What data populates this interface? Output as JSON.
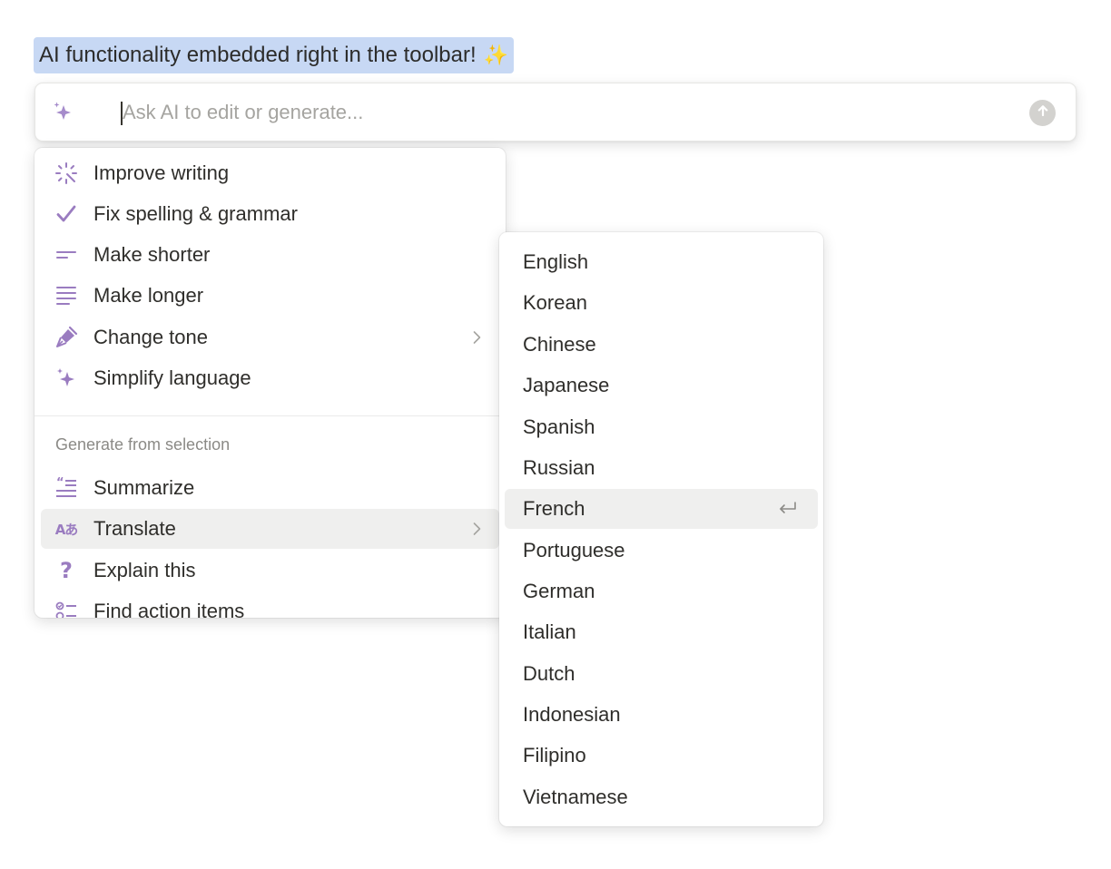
{
  "selection": {
    "text": "AI functionality embedded right in the toolbar!",
    "emoji": "✨"
  },
  "ai_bar": {
    "placeholder": "Ask AI to edit or generate...",
    "value": "",
    "icon": "sparkle-icon",
    "submit_icon": "arrow-up-icon"
  },
  "menu": {
    "edit_items": [
      {
        "label": "Improve writing",
        "icon": "magic-wand-icon"
      },
      {
        "label": "Fix spelling & grammar",
        "icon": "checkmark-icon"
      },
      {
        "label": "Make shorter",
        "icon": "short-lines-icon"
      },
      {
        "label": "Make longer",
        "icon": "long-lines-icon"
      },
      {
        "label": "Change tone",
        "icon": "pen-nib-icon",
        "has_submenu": true
      },
      {
        "label": "Simplify language",
        "icon": "sparkle-icon"
      }
    ],
    "section_label": "Generate from selection",
    "generate_items": [
      {
        "label": "Summarize",
        "icon": "quote-lines-icon"
      },
      {
        "label": "Translate",
        "icon": "translate-icon",
        "has_submenu": true,
        "active": true,
        "icon_text": "Aあ"
      },
      {
        "label": "Explain this",
        "icon": "question-mark-icon",
        "icon_text": "?"
      },
      {
        "label": "Find action items",
        "icon": "checklist-icon"
      }
    ]
  },
  "languages": {
    "items": [
      "English",
      "Korean",
      "Chinese",
      "Japanese",
      "Spanish",
      "Russian",
      "French",
      "Portuguese",
      "German",
      "Italian",
      "Dutch",
      "Indonesian",
      "Filipino",
      "Vietnamese"
    ],
    "selected": "French",
    "enter_icon": "enter-return-icon"
  },
  "colors": {
    "accent_purple": "#9a7cc0",
    "selection_highlight": "#c7d8f4",
    "active_row": "#efefee"
  }
}
